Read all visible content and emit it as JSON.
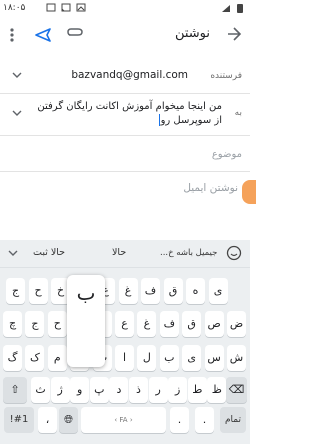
{
  "status_bar": {
    "time": "۱۸:۰۵",
    "icons": [
      "sim-icon",
      "cast-icon",
      "image-icon",
      "wifi-icon",
      "signal-icon",
      "battery-icon"
    ]
  },
  "app_bar": {
    "title": "نوشتن",
    "icons": [
      "back-arrow-icon",
      "attach-icon",
      "send-icon",
      "more-icon"
    ]
  },
  "from": {
    "label": "فرستنده",
    "value": "bazvandq@gmail.com"
  },
  "to": {
    "label": "به",
    "value": "من اینجا میخوام آموزش اکانت رایگان گرفتن از سوپرسل رو"
  },
  "subject": {
    "placeholder": "موضوع"
  },
  "body": {
    "placeholder": "نوشتن ایمیل"
  },
  "keyboard": {
    "suggestions": [
      "حالا ثبت",
      "حالا",
      "جیمیل باشه خ..."
    ],
    "popup_char": "ب",
    "row1": [
      "ض",
      "ص",
      "ق",
      "ف",
      "غ",
      "ع",
      "ه",
      "خ",
      "ح",
      "ج",
      "چ"
    ],
    "row2": [
      "ش",
      "س",
      "ی",
      "ب",
      "ل",
      "ا",
      "ت",
      "ن",
      "م",
      "ک",
      "گ"
    ],
    "row3": [
      "ظ",
      "ط",
      "ز",
      "ر",
      "ذ",
      "د",
      "پ",
      "و",
      "ژ",
      "ث"
    ],
    "row0": [
      "ی",
      "ه",
      "ق",
      "ف",
      "غ",
      "ع",
      "ه",
      "خ",
      "ح",
      "ج"
    ],
    "sym": "!#1",
    "comma": "،",
    "space_label": "FA",
    "period": ".",
    "enter_label": "تمام"
  }
}
